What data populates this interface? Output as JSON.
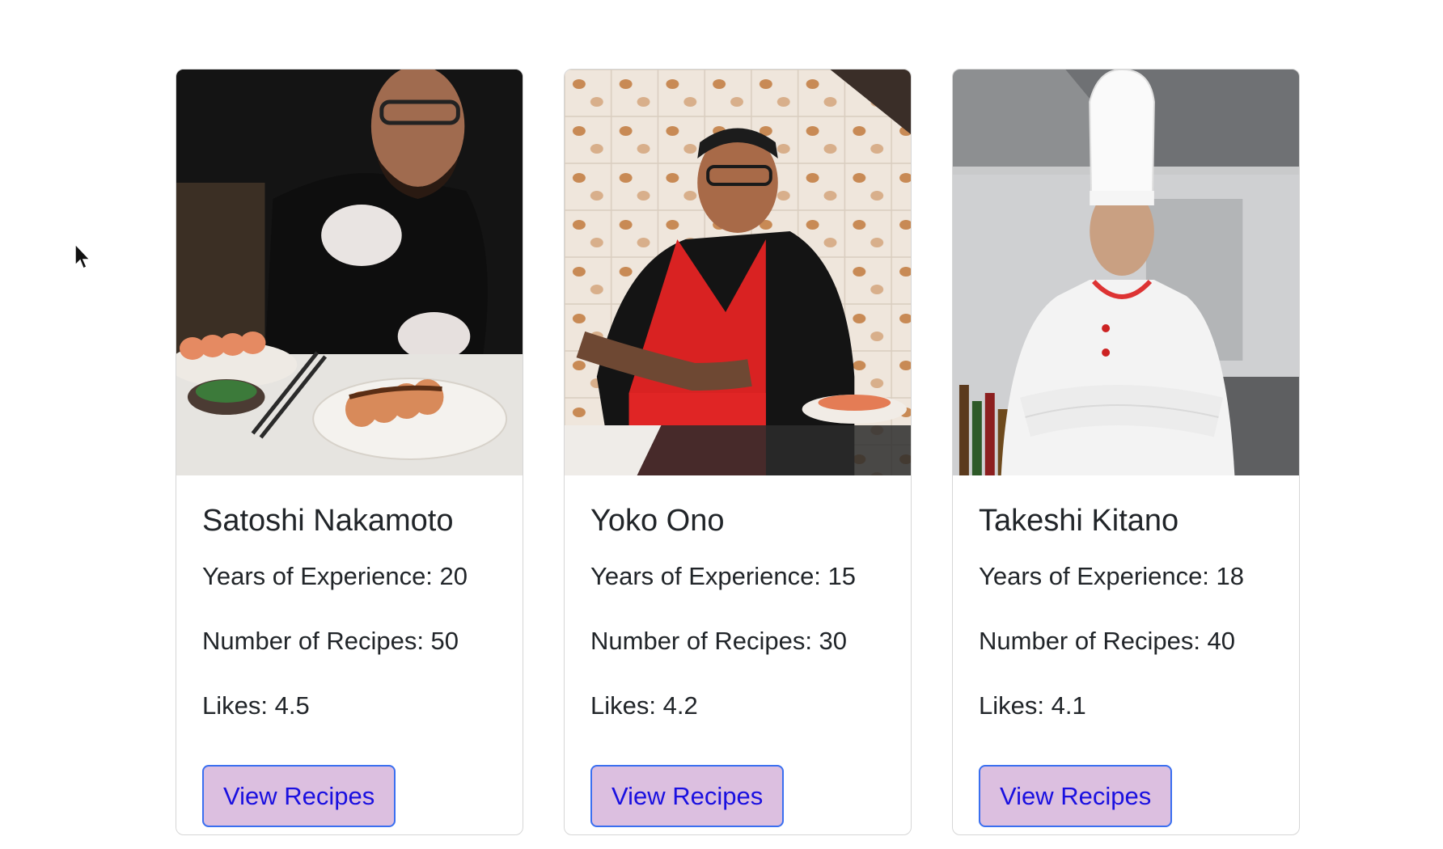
{
  "colors": {
    "button_bg": "#dcbfe0",
    "button_text": "#1a10e0",
    "button_border": "#3a6ff0"
  },
  "chefs": [
    {
      "name": "Satoshi Nakamoto",
      "experience": "Years of Experience: 20",
      "recipes": "Number of Recipes: 50",
      "likes": "Likes: 4.5",
      "button_label": "View Recipes",
      "photo": "chef-photo-sushi-plating"
    },
    {
      "name": "Yoko Ono",
      "experience": "Years of Experience: 15",
      "recipes": "Number of Recipes: 30",
      "likes": "Likes: 4.2",
      "button_label": "View Recipes",
      "photo": "chef-photo-torch-sushi"
    },
    {
      "name": "Takeshi Kitano",
      "experience": "Years of Experience: 18",
      "recipes": "Number of Recipes: 40",
      "likes": "Likes: 4.1",
      "button_label": "View Recipes",
      "photo": "chef-photo-kitchen-portrait"
    }
  ]
}
